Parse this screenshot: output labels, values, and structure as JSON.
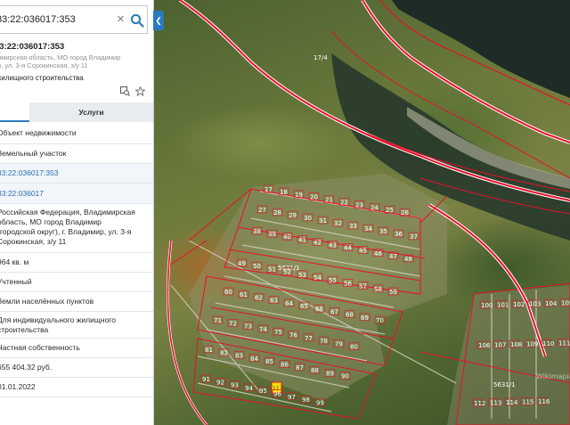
{
  "search": {
    "value": "33:22:036017:353"
  },
  "card": {
    "title": "33:22:036017:353",
    "address_line1": "имирская область, МО город Владимир",
    "address_line2": "р, ул. 3-я Сорокинская, з/у 11",
    "purpose": "жилищного строительства"
  },
  "tabs": {
    "services": "Услуги"
  },
  "rows": [
    "Объект недвижимости",
    "Земельный участок",
    "33:22:036017:353",
    "33:22:036017",
    "Российская Федерация, Владимирская",
    "область, МО город Владимир",
    "(городской округ), г. Владимир, ул. 3-я",
    "Сорокинская, з/у 11",
    "964 кв. м",
    "Учтенный",
    "Земли населённых пунктов",
    "Для индивидуального жилищного",
    "строительства",
    "Частная собственность",
    "655 404,32 руб.",
    "01.01.2022"
  ],
  "map": {
    "labels": [
      "17/4",
      "5631/1",
      "5631/1"
    ],
    "parcel_numbers": [
      "17",
      "18",
      "19",
      "20",
      "21",
      "22",
      "23",
      "24",
      "25",
      "26",
      "27",
      "28",
      "29",
      "30",
      "31",
      "32",
      "33",
      "34",
      "35",
      "36",
      "37",
      "38",
      "39",
      "40",
      "41",
      "42",
      "43",
      "44",
      "45",
      "46",
      "47",
      "48",
      "49",
      "50",
      "51",
      "52",
      "53",
      "54",
      "55",
      "56",
      "57",
      "58",
      "59",
      "60",
      "61",
      "62",
      "63",
      "64",
      "65",
      "66",
      "67",
      "68",
      "69",
      "70",
      "71",
      "72",
      "73",
      "74",
      "75",
      "76",
      "77",
      "78",
      "79",
      "80",
      "81",
      "82",
      "83",
      "84",
      "85",
      "86",
      "87",
      "88",
      "89",
      "90",
      "91",
      "92",
      "93",
      "94",
      "95",
      "96",
      "97",
      "98",
      "99",
      "100",
      "101",
      "102",
      "103",
      "104",
      "105",
      "106",
      "107",
      "108",
      "109",
      "110",
      "111",
      "112",
      "113",
      "114",
      "115",
      "116"
    ],
    "highlight_parcel": "11",
    "watermark": "Wikimapia"
  },
  "colors": {
    "boundary": "#e8102a",
    "accent": "#2a7ac0",
    "highlight": "#f5e000"
  }
}
